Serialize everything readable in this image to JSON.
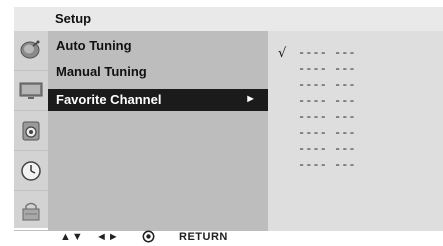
{
  "header": {
    "title": "Setup"
  },
  "sidebar": {
    "icons": [
      "satellite-dish-icon",
      "tv-monitor-icon",
      "speaker-icon",
      "clock-icon",
      "lock-icon"
    ]
  },
  "menu": {
    "items": [
      {
        "label": "Auto Tuning",
        "selected": false
      },
      {
        "label": "Manual Tuning",
        "selected": false
      },
      {
        "label": "Favorite Channel",
        "selected": true,
        "arrow": "►"
      }
    ]
  },
  "channels": {
    "check": "√",
    "slots": [
      "---- ---",
      "---- ---",
      "---- ---",
      "---- ---",
      "---- ---",
      "---- ---",
      "---- ---",
      "---- ---"
    ]
  },
  "footer": {
    "updown": "▲▼",
    "leftright": "◄►",
    "return_label": "RETURN"
  },
  "colors": {
    "selected_bg": "#1b1b1b",
    "menu_bg": "#bdbdbd",
    "panel_bg": "#dedede",
    "header_bg": "#e9e9e9",
    "icon_col_bg": "#d3d3d3"
  }
}
